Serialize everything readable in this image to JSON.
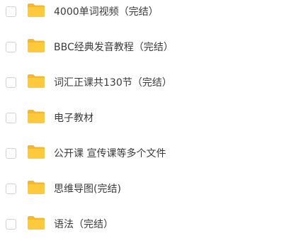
{
  "file_list": {
    "folder_color": "#ffc93c",
    "folder_tab_color": "#f5b82a",
    "items": [
      {
        "name": "4000单词视频（完结）",
        "icon": "folder-icon",
        "checked": false
      },
      {
        "name": "BBC经典发音教程（完结）",
        "icon": "folder-icon",
        "checked": false
      },
      {
        "name": "词汇正课共130节（完结）",
        "icon": "folder-icon",
        "checked": false
      },
      {
        "name": "电子教材",
        "icon": "folder-icon",
        "checked": false
      },
      {
        "name": "公开课 宣传课等多个文件",
        "icon": "folder-icon",
        "checked": false
      },
      {
        "name": "思维导图(完结)",
        "icon": "folder-icon",
        "checked": false
      },
      {
        "name": "语法（完结）",
        "icon": "folder-icon",
        "checked": false
      }
    ]
  }
}
